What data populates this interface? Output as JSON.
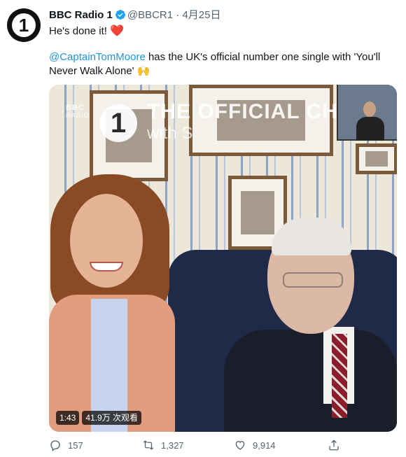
{
  "account": {
    "name": "BBC Radio 1",
    "handle": "@BBCR1",
    "separator": "·",
    "date": "4月25日",
    "avatar_text": "1"
  },
  "tweet": {
    "line1_text": "He's done it!",
    "line1_emoji": "❤️",
    "mention": "@CaptainTomMoore",
    "line2_text": " has the UK's official number one single with 'You'll Never Walk Alone'",
    "line2_emoji": "🙌"
  },
  "media": {
    "station_logo_line1": "BBC",
    "station_logo_line2": "RADIO",
    "logo_number": "1",
    "overlay_title": "THE OFFICIAL CHART",
    "overlay_subtitle": "with S",
    "duration": "1:43",
    "views": "41.9万 次观看"
  },
  "actions": {
    "replies": "157",
    "retweets": "1,327",
    "likes": "9,914"
  },
  "icons": {
    "avatar": "bbc-radio-1-logo",
    "verified": "verified-badge-icon",
    "reply": "reply-icon",
    "retweet": "retweet-icon",
    "like": "heart-icon",
    "share": "share-icon"
  },
  "colors": {
    "link": "#1b95e0",
    "verified": "#1da1f2",
    "heart": "#e0245e",
    "muted": "#536471"
  }
}
